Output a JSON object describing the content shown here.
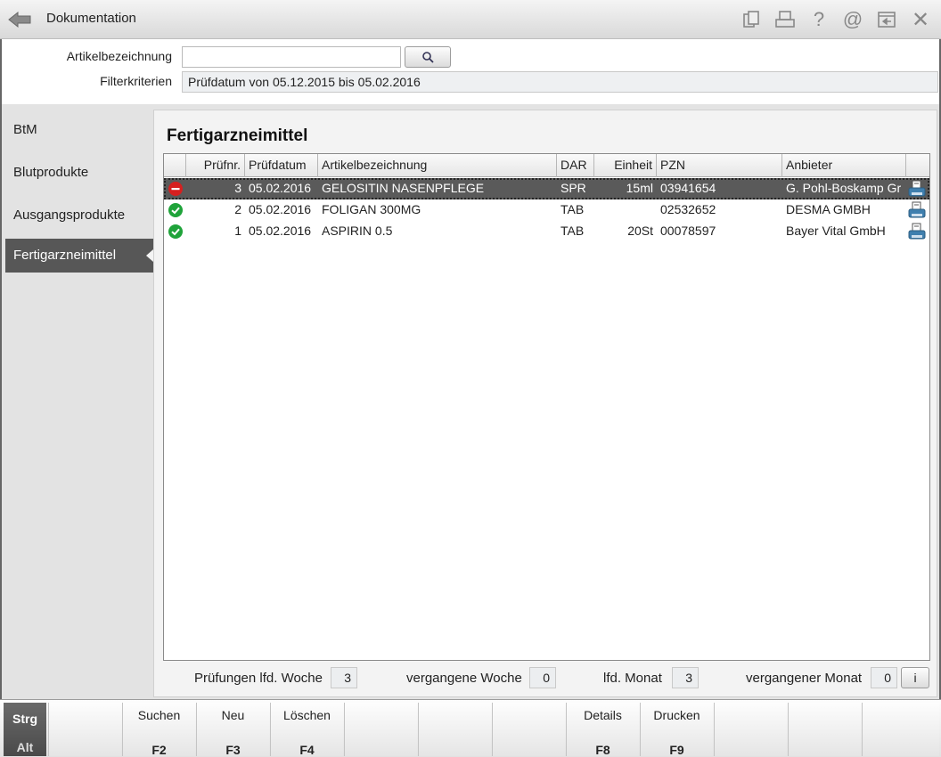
{
  "window": {
    "title": "Dokumentation"
  },
  "toolbar_icons": [
    "document-icon",
    "print-icon",
    "help-icon",
    "email-icon",
    "window-icon",
    "close-icon"
  ],
  "filter": {
    "article_label": "Artikelbezeichnung",
    "article_value": "",
    "criteria_label": "Filterkriterien",
    "criteria_value": "Prüfdatum von 05.12.2015 bis 05.02.2016"
  },
  "sidebar": {
    "items": [
      {
        "label": "BtM",
        "active": false
      },
      {
        "label": "Blutprodukte",
        "active": false
      },
      {
        "label": "Ausgangsprodukte",
        "active": false
      },
      {
        "label": "Fertigarzneimittel",
        "active": true
      }
    ]
  },
  "main": {
    "title": "Fertigarzneimittel",
    "columns": [
      "",
      "Prüfnr.",
      "Prüfdatum",
      "Artikelbezeichnung",
      "DAR",
      "Einheit",
      "PZN",
      "Anbieter",
      ""
    ],
    "rows": [
      {
        "status": "error",
        "pruefnr": "3",
        "datum": "05.02.2016",
        "artikel": "GELOSITIN NASENPFLEGE",
        "dar": "SPR",
        "einheit": "15ml",
        "pzn": "03941654",
        "anbieter": "G. Pohl-Boskamp Gr",
        "selected": true
      },
      {
        "status": "ok",
        "pruefnr": "2",
        "datum": "05.02.2016",
        "artikel": "FOLIGAN 300MG",
        "dar": "TAB",
        "einheit": "",
        "pzn": "02532652",
        "anbieter": "DESMA GMBH",
        "selected": false
      },
      {
        "status": "ok",
        "pruefnr": "1",
        "datum": "05.02.2016",
        "artikel": "ASPIRIN 0.5",
        "dar": "TAB",
        "einheit": "20St",
        "pzn": "00078597",
        "anbieter": "Bayer Vital GmbH",
        "selected": false
      }
    ]
  },
  "stats": {
    "week_label": "Prüfungen lfd. Woche",
    "week_value": "3",
    "prev_week_label": "vergangene Woche",
    "prev_week_value": "0",
    "month_label": "lfd. Monat",
    "month_value": "3",
    "prev_month_label": "vergangener Monat",
    "prev_month_value": "0",
    "info_label": "i"
  },
  "fkeys": {
    "strg": "Strg",
    "alt": "Alt",
    "keys": [
      {
        "label": "",
        "key": ""
      },
      {
        "label": "Suchen",
        "key": "F2"
      },
      {
        "label": "Neu",
        "key": "F3"
      },
      {
        "label": "Löschen",
        "key": "F4"
      },
      {
        "label": "",
        "key": ""
      },
      {
        "label": "",
        "key": ""
      },
      {
        "label": "",
        "key": ""
      },
      {
        "label": "Details",
        "key": "F8"
      },
      {
        "label": "Drucken",
        "key": "F9"
      },
      {
        "label": "",
        "key": ""
      },
      {
        "label": "",
        "key": ""
      },
      {
        "label": "",
        "key": ""
      }
    ]
  },
  "colors": {
    "active_tab": "#575757",
    "ok": "#1fa33a",
    "error": "#d62020"
  }
}
